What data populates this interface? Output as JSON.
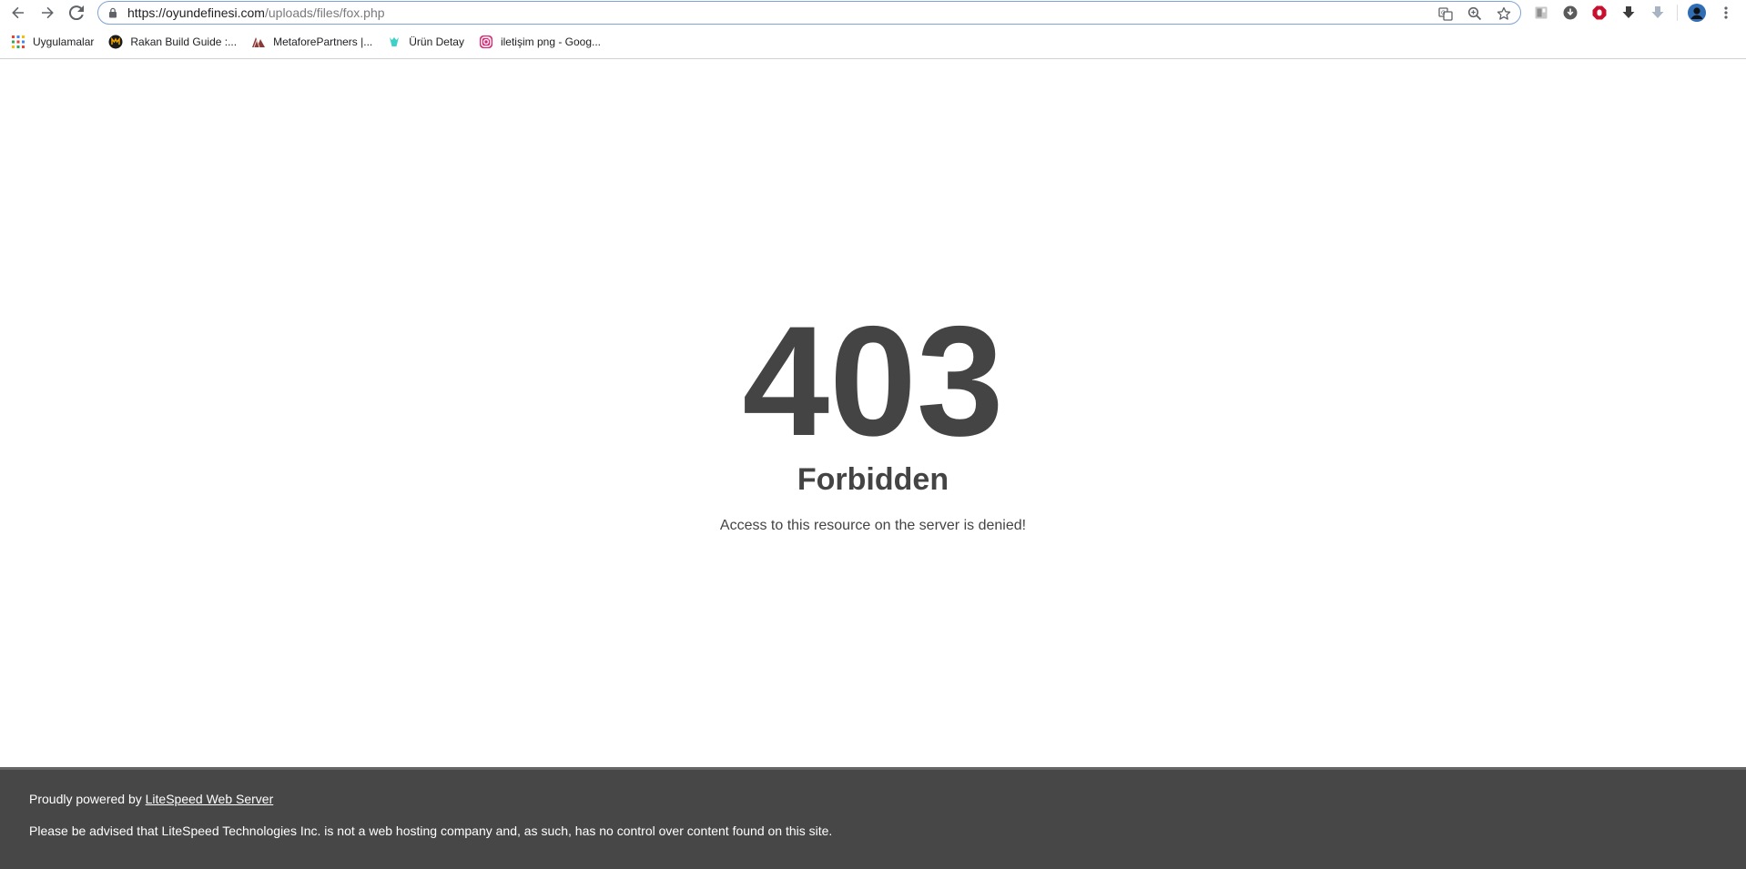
{
  "browser": {
    "url_host": "https://oyundefinesi.com",
    "url_path": "/uploads/files/fox.php",
    "bookmarks": [
      {
        "label": "Uygulamalar",
        "icon": "apps-grid-icon"
      },
      {
        "label": "Rakan Build Guide :...",
        "icon": "site-logo-icon"
      },
      {
        "label": "MetaforePartners |...",
        "icon": "site-logo-icon"
      },
      {
        "label": "Ürün Detay",
        "icon": "site-logo-icon"
      },
      {
        "label": "iletişim png - Goog...",
        "icon": "instagram-icon"
      }
    ]
  },
  "page": {
    "code": "403",
    "title": "Forbidden",
    "message": "Access to this resource on the server is denied!"
  },
  "footer": {
    "powered_prefix": "Proudly powered by ",
    "powered_link": "LiteSpeed Web Server",
    "disclaimer": "Please be advised that LiteSpeed Technologies Inc. is not a web hosting company and, as such, has no control over content found on this site."
  },
  "colors": {
    "text": "#444444",
    "footer_bg": "#474747",
    "omnibox_border": "#7ea3d8"
  }
}
